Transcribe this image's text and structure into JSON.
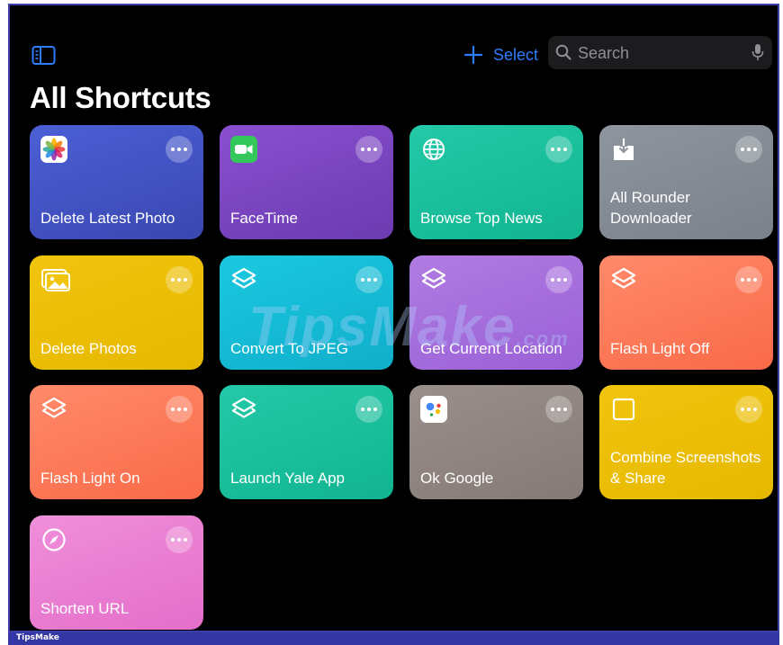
{
  "toolbar": {
    "select_label": "Select",
    "search_placeholder": "Search"
  },
  "page_title": "All Shortcuts",
  "shortcuts": [
    {
      "label": "Delete Latest Photo",
      "icon": "photos-app-icon",
      "color_top": "#4c5fd6",
      "color_bottom": "#3947b0"
    },
    {
      "label": "FaceTime",
      "icon": "facetime-icon",
      "color_top": "#8a4fd0",
      "color_bottom": "#6b3bb0"
    },
    {
      "label": "Browse Top News",
      "icon": "globe-icon",
      "color_top": "#23c9a8",
      "color_bottom": "#11b48f"
    },
    {
      "label": "All Rounder Downloader",
      "icon": "download-icon",
      "color_top": "#8f959e",
      "color_bottom": "#7a818b"
    },
    {
      "label": "Delete Photos",
      "icon": "photo-stack-icon",
      "color_top": "#f1c40f",
      "color_bottom": "#e6b800"
    },
    {
      "label": "Convert To JPEG",
      "icon": "layers-icon",
      "color_top": "#1bc8e0",
      "color_bottom": "#10aeca"
    },
    {
      "label": "Get Current Location",
      "icon": "layers-icon",
      "color_top": "#b07ce2",
      "color_bottom": "#9a60d6"
    },
    {
      "label": "Flash Light Off",
      "icon": "layers-icon",
      "color_top": "#ff8a6a",
      "color_bottom": "#f96a48"
    },
    {
      "label": "Flash Light On",
      "icon": "layers-icon",
      "color_top": "#ff8a6a",
      "color_bottom": "#f96a48"
    },
    {
      "label": "Launch Yale App",
      "icon": "layers-icon",
      "color_top": "#23c9a8",
      "color_bottom": "#11b48f"
    },
    {
      "label": "Ok Google",
      "icon": "google-assistant-icon",
      "color_top": "#9a8f8a",
      "color_bottom": "#857a76"
    },
    {
      "label": "Combine Screenshots & Share",
      "icon": "square-icon",
      "color_top": "#f1c40f",
      "color_bottom": "#e6b800"
    },
    {
      "label": "Shorten URL",
      "icon": "compass-icon",
      "color_top": "#ef8fda",
      "color_bottom": "#e46ec9"
    }
  ],
  "watermark": {
    "text": "TipsMake",
    "suffix": ".com"
  },
  "footer_brand": "TipsMake",
  "colors": {
    "accent": "#2f7dff",
    "background": "#000000",
    "frame": "#3d3fa8"
  }
}
